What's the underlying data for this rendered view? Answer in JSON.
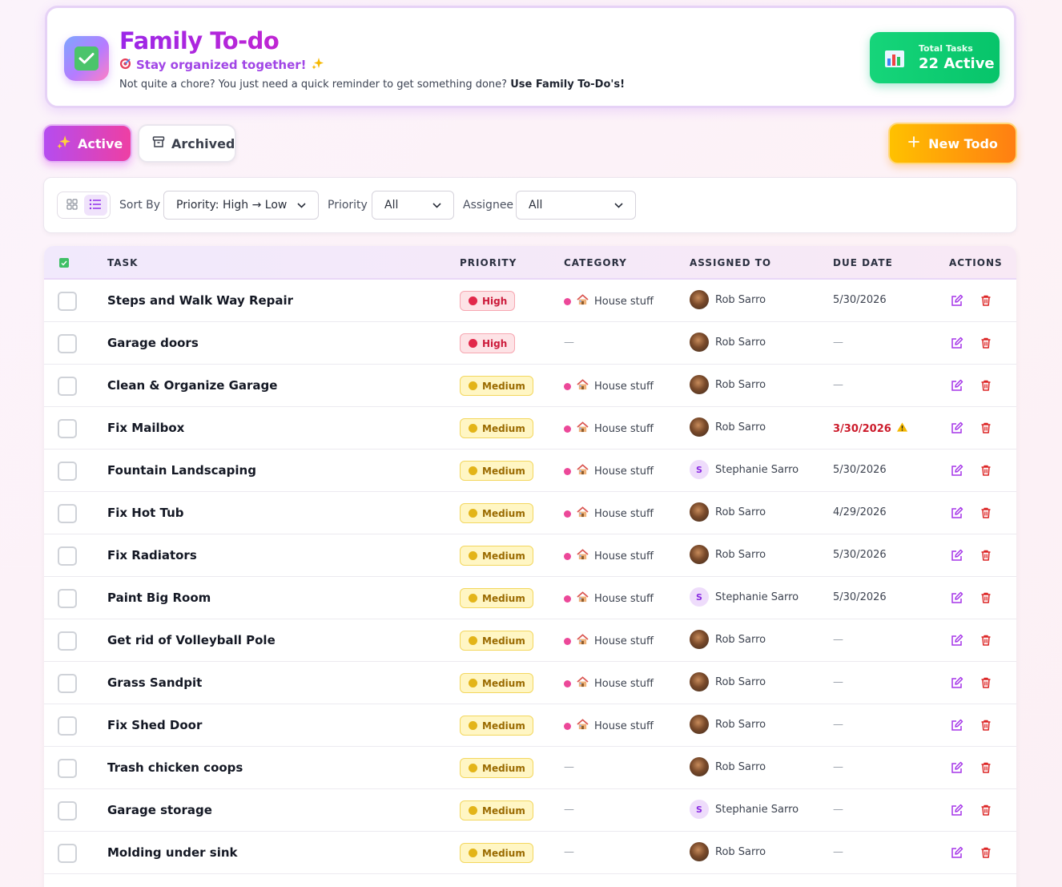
{
  "header": {
    "title": "Family To-do",
    "subtitle": "Stay organized together!",
    "tagline_prefix": "Not quite a chore? You just need a quick reminder to get something done?",
    "tagline_bold": "Use Family To-Do's!",
    "total_label": "Total Tasks",
    "total_value": "22 Active"
  },
  "tabs": {
    "active_label": "Active",
    "archived_label": "Archived"
  },
  "new_button_label": "New Todo",
  "filters": {
    "sort_label": "Sort By",
    "sort_value": "Priority: High → Low",
    "priority_label": "Priority",
    "priority_value": "All",
    "assignee_label": "Assignee",
    "assignee_value": "All"
  },
  "table": {
    "headers": {
      "task": "TASK",
      "priority": "PRIORITY",
      "category": "CATEGORY",
      "assigned": "ASSIGNED TO",
      "due": "DUE DATE",
      "actions": "ACTIONS"
    },
    "rows": [
      {
        "task": "Steps and Walk Way Repair",
        "priority": "High",
        "category": "House stuff",
        "assignee": "Rob Sarro",
        "due": "5/30/2026"
      },
      {
        "task": "Garage doors",
        "priority": "High",
        "category": "—",
        "assignee": "Rob Sarro",
        "due": "—"
      },
      {
        "task": "Clean & Organize Garage",
        "priority": "Medium",
        "category": "House stuff",
        "assignee": "Rob Sarro",
        "due": "—"
      },
      {
        "task": "Fix Mailbox",
        "priority": "Medium",
        "category": "House stuff",
        "assignee": "Rob Sarro",
        "due": "3/30/2026"
      },
      {
        "task": "Fountain Landscaping",
        "priority": "Medium",
        "category": "House stuff",
        "assignee": "Stephanie Sarro",
        "due": "5/30/2026"
      },
      {
        "task": "Fix Hot Tub",
        "priority": "Medium",
        "category": "House stuff",
        "assignee": "Rob Sarro",
        "due": "4/29/2026"
      },
      {
        "task": "Fix Radiators",
        "priority": "Medium",
        "category": "House stuff",
        "assignee": "Rob Sarro",
        "due": "5/30/2026"
      },
      {
        "task": "Paint Big Room",
        "priority": "Medium",
        "category": "House stuff",
        "assignee": "Stephanie Sarro",
        "due": "5/30/2026"
      },
      {
        "task": "Get rid of Volleyball Pole",
        "priority": "Medium",
        "category": "House stuff",
        "assignee": "Rob Sarro",
        "due": "—"
      },
      {
        "task": "Grass Sandpit",
        "priority": "Medium",
        "category": "House stuff",
        "assignee": "Rob Sarro",
        "due": "—"
      },
      {
        "task": "Fix Shed Door",
        "priority": "Medium",
        "category": "House stuff",
        "assignee": "Rob Sarro",
        "due": "—"
      },
      {
        "task": "Trash chicken coops",
        "priority": "Medium",
        "category": "—",
        "assignee": "Rob Sarro",
        "due": "—"
      },
      {
        "task": "Garage storage",
        "priority": "Medium",
        "category": "—",
        "assignee": "Stephanie Sarro",
        "due": "—"
      },
      {
        "task": "Molding under sink",
        "priority": "Medium",
        "category": "—",
        "assignee": "Rob Sarro",
        "due": "—"
      }
    ]
  },
  "avatars": {
    "stephanie_initial": "S"
  },
  "colors": {
    "accent": "#a855f7",
    "pink": "#ec4899",
    "green": "#10c46a",
    "orange": "#ff8a00"
  },
  "icons": [
    "check-icon",
    "target-icon",
    "sparkle-icon",
    "chart-icon",
    "archive-icon",
    "plus-icon",
    "grid-icon",
    "list-icon",
    "chevron-down-icon",
    "house-icon",
    "warning-icon",
    "edit-icon",
    "trash-icon"
  ]
}
